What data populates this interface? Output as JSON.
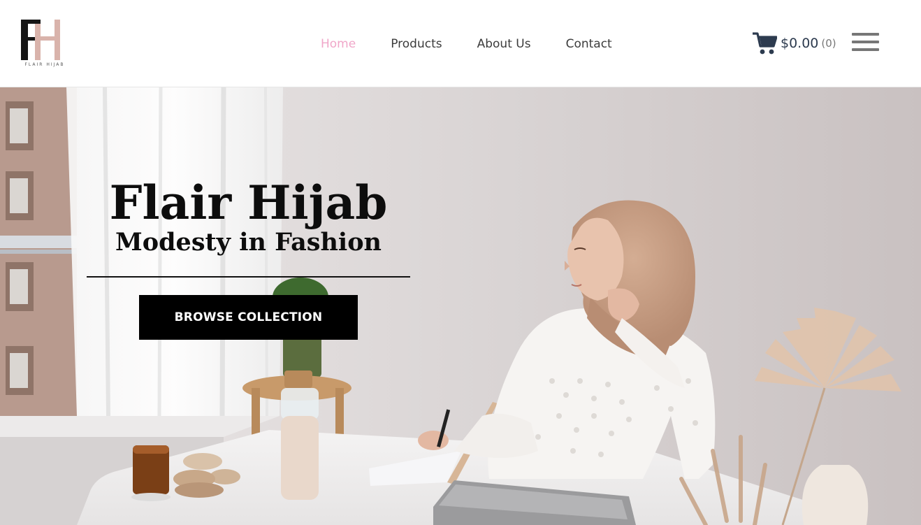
{
  "brand": {
    "monogram": "FH",
    "name": "FLAIR HIJAB"
  },
  "nav": {
    "items": [
      {
        "label": "Home",
        "active": true
      },
      {
        "label": "Products",
        "active": false
      },
      {
        "label": "About Us",
        "active": false
      },
      {
        "label": "Contact",
        "active": false
      }
    ]
  },
  "cart": {
    "total": "$0.00",
    "count": "(0)",
    "icon": "cart-icon"
  },
  "menu": {
    "icon": "hamburger-icon"
  },
  "hero": {
    "title": "Flair Hijab",
    "subtitle": "Modesty in Fashion",
    "cta_label": "BROWSE COLLECTION"
  },
  "colors": {
    "nav_active": "#f0a7c9",
    "cart_text": "#2d3b4f",
    "button_bg": "#000000",
    "hero_wall": "#d7d1d1"
  }
}
